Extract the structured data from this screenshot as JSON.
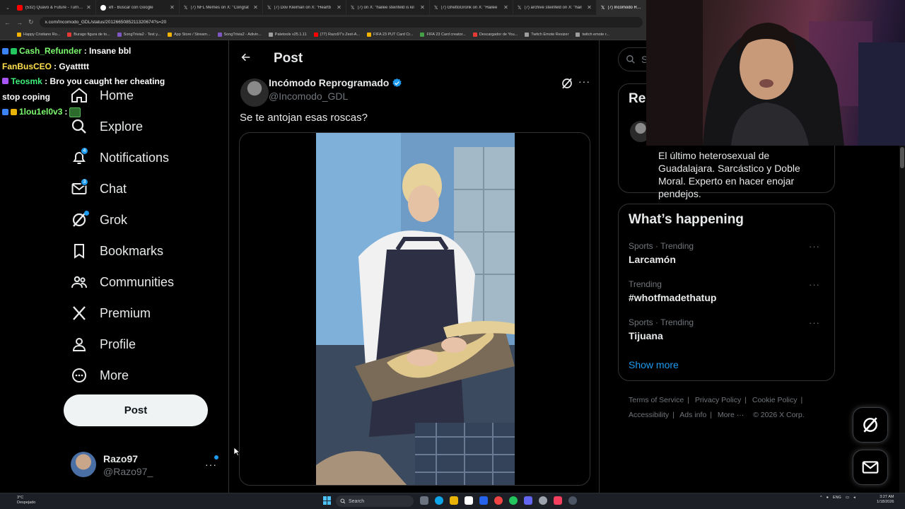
{
  "browser": {
    "tabs": [
      {
        "label": "(532) Quavo & Future - Turn Yo",
        "color": "#ff0000"
      },
      {
        "label": "efl - Buscar con Google",
        "color": "#ffffff"
      },
      {
        "label": "(7) NFL Memes on X: \"Congrat",
        "color": "#ffffff"
      },
      {
        "label": "(7) Dov Kleiman on X: \"Heartb",
        "color": "#ffffff"
      },
      {
        "label": "(7) on X: \"hailee steinfeld is kil",
        "color": "#ffffff"
      },
      {
        "label": "(7) GhettoGronk on X: \"Hailee",
        "color": "#ffffff"
      },
      {
        "label": "(7) archive steinfeld on X: \"hail",
        "color": "#ffffff"
      },
      {
        "label": "(7) Incómodo Rep",
        "color": "#ffffff"
      }
    ],
    "url": "x.com/Incomodo_GDL/status/2012665085211320674?s=20",
    "bookmarks": [
      {
        "label": "Happy Cristiano Ro...",
        "color": "#f4b400"
      },
      {
        "label": "Burago figura de to...",
        "color": "#e53935"
      },
      {
        "label": "SongTrivia2 - Test y...",
        "color": "#7e57c2"
      },
      {
        "label": "App Store / Stream...",
        "color": "#f4b400"
      },
      {
        "label": "SongTrivia2 - Adivin...",
        "color": "#7e57c2"
      },
      {
        "label": "Paletools v25.1.11",
        "color": "#9e9e9e"
      },
      {
        "label": "(77) Razo97's Zest-A...",
        "color": "#ff0000"
      },
      {
        "label": "FIFA 23 PUT Card Cr...",
        "color": "#f4b400"
      },
      {
        "label": "FIFA 23 Card creator...",
        "color": "#43a047"
      },
      {
        "label": "Descargador de You...",
        "color": "#e53935"
      },
      {
        "label": "Twitch Emote Resizer",
        "color": "#9e9e9e"
      },
      {
        "label": "twitch emote r...",
        "color": "#9e9e9e"
      }
    ]
  },
  "chat": [
    {
      "user": "Cash_Refunder",
      "message": ": Insane bbl"
    },
    {
      "user": "FanBusCEO",
      "message": ": Gyattttt"
    },
    {
      "user": "Teosmk",
      "message": ": Bro you caught her cheating stop coping"
    },
    {
      "user": "1lou1el0v3",
      "message": ":"
    }
  ],
  "nav": {
    "items": [
      {
        "label": "Home",
        "icon": "home-icon"
      },
      {
        "label": "Explore",
        "icon": "search-icon"
      },
      {
        "label": "Notifications",
        "icon": "bell-icon",
        "badge": "4"
      },
      {
        "label": "Chat",
        "icon": "mail-icon",
        "badge": "3"
      },
      {
        "label": "Grok",
        "icon": "grok-icon"
      },
      {
        "label": "Bookmarks",
        "icon": "bookmark-icon"
      },
      {
        "label": "Communities",
        "icon": "communities-icon"
      },
      {
        "label": "Premium",
        "icon": "x-logo-icon"
      },
      {
        "label": "Profile",
        "icon": "person-icon"
      },
      {
        "label": "More",
        "icon": "more-circle-icon"
      }
    ],
    "post_button": "Post",
    "account": {
      "name": "Razo97",
      "handle": "@Razo97_"
    }
  },
  "main": {
    "title": "Post",
    "author": {
      "name": "Incómodo Reprogramado",
      "handle": "@Incomodo_GDL"
    },
    "text": "Se te antojan esas roscas?"
  },
  "right": {
    "search_placeholder": "Se",
    "relevant_title": "Rel",
    "bio": "El último heterosexual de Guadalajara. Sarcástico y Doble Moral. Experto en hacer enojar pendejos.",
    "happening_title": "What’s happening",
    "trends": [
      {
        "meta": "Sports · Trending",
        "name": "Larcamón"
      },
      {
        "meta": "Trending",
        "name": "#whotfmadethatup"
      },
      {
        "meta": "Sports · Trending",
        "name": "Tijuana"
      }
    ],
    "show_more": "Show more",
    "footer": {
      "terms": "Terms of Service",
      "privacy": "Privacy Policy",
      "cookie": "Cookie Policy",
      "accessibility": "Accessibility",
      "ads": "Ads info",
      "more": "More ···",
      "copyright": "© 2026 X Corp."
    }
  },
  "taskbar": {
    "weather_temp": "3°C",
    "weather_text": "Despejado",
    "search": "Search",
    "lang": "ENG",
    "time": "3:27 AM",
    "date": "1/18/2026"
  },
  "colors": {
    "accent": "#1d9bf0",
    "background": "#000000",
    "text": "#e7e9ea",
    "muted": "#71767b"
  }
}
